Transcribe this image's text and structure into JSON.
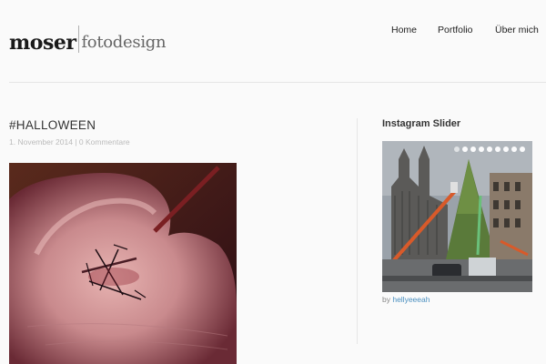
{
  "header": {
    "logo_bold": "moser",
    "logo_light": "fotodesign",
    "nav": [
      "Home",
      "Portfolio",
      "Über mich"
    ]
  },
  "post": {
    "title": "#HALLOWEEN",
    "date": "1. November 2014",
    "separator": " | ",
    "comments": "0 Kommentare"
  },
  "sidebar": {
    "widget_title": "Instagram Slider",
    "by_prefix": "by ",
    "author": "hellyeeeah",
    "slide_count": 9
  }
}
